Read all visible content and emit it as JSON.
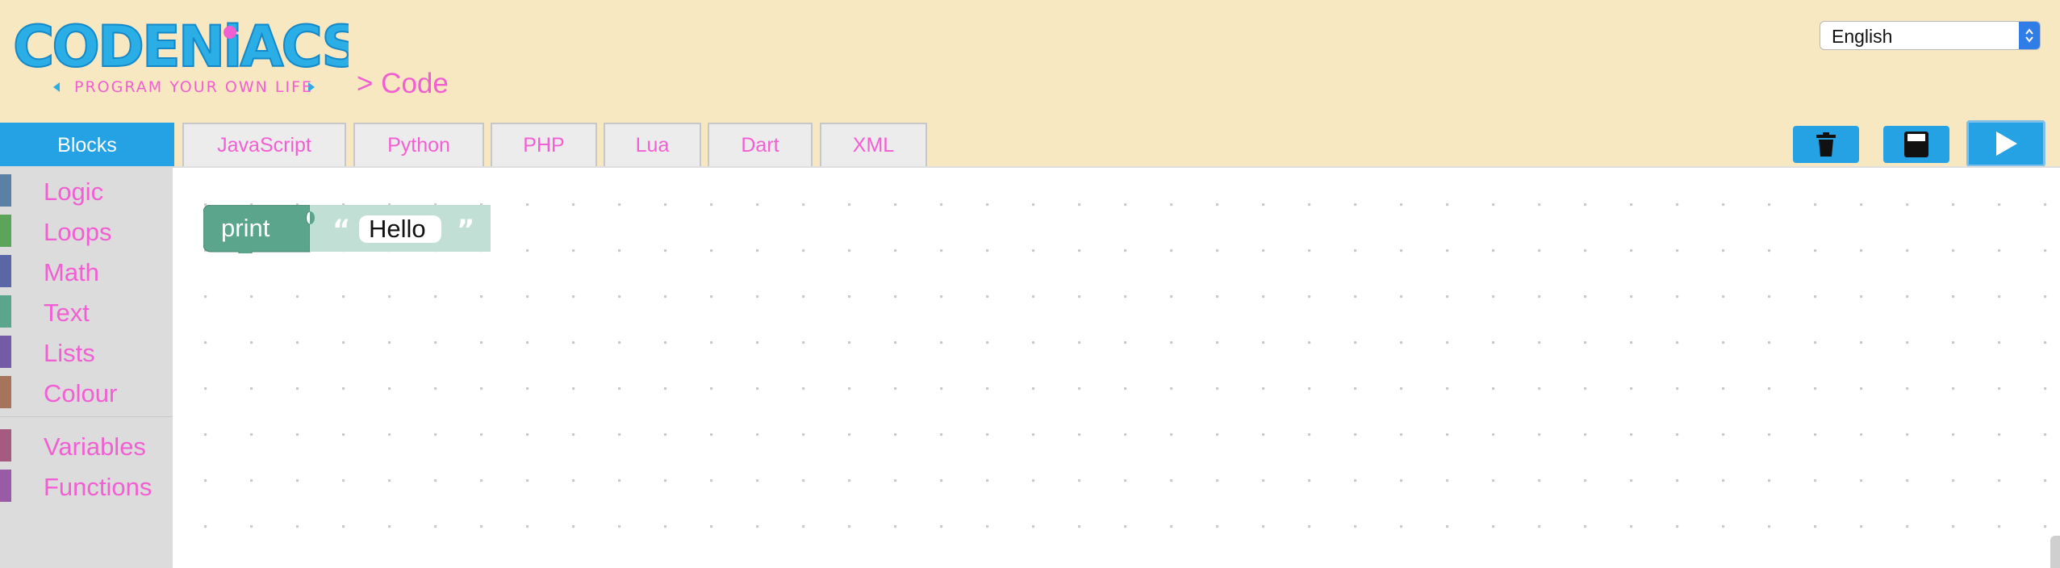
{
  "header": {
    "logo_text": "CODENiACS",
    "logo_tagline": "PROGRAM YOUR OWN LIFE",
    "breadcrumb": "> Code",
    "language": {
      "selected": "English"
    }
  },
  "tabs": [
    {
      "label": "Blocks",
      "active": true
    },
    {
      "label": "JavaScript"
    },
    {
      "label": "Python"
    },
    {
      "label": "PHP"
    },
    {
      "label": "Lua"
    },
    {
      "label": "Dart"
    },
    {
      "label": "XML"
    }
  ],
  "toolbar": {
    "trash_icon": "trash-icon",
    "save_icon": "save-icon",
    "run_icon": "play-icon"
  },
  "toolbox": {
    "categories": [
      {
        "label": "Logic",
        "color": "#5b80a5"
      },
      {
        "label": "Loops",
        "color": "#5ba55b"
      },
      {
        "label": "Math",
        "color": "#5b67a5"
      },
      {
        "label": "Text",
        "color": "#5ba58c"
      },
      {
        "label": "Lists",
        "color": "#745ba5"
      },
      {
        "label": "Colour",
        "color": "#a5745b"
      },
      {
        "label": "Variables",
        "color": "#a55b80"
      },
      {
        "label": "Functions",
        "color": "#995ba5"
      }
    ]
  },
  "workspace": {
    "block": {
      "keyword": "print",
      "string_value": "Hello",
      "open_quote": "“",
      "close_quote": "”",
      "color": "#5ba58c"
    }
  }
}
